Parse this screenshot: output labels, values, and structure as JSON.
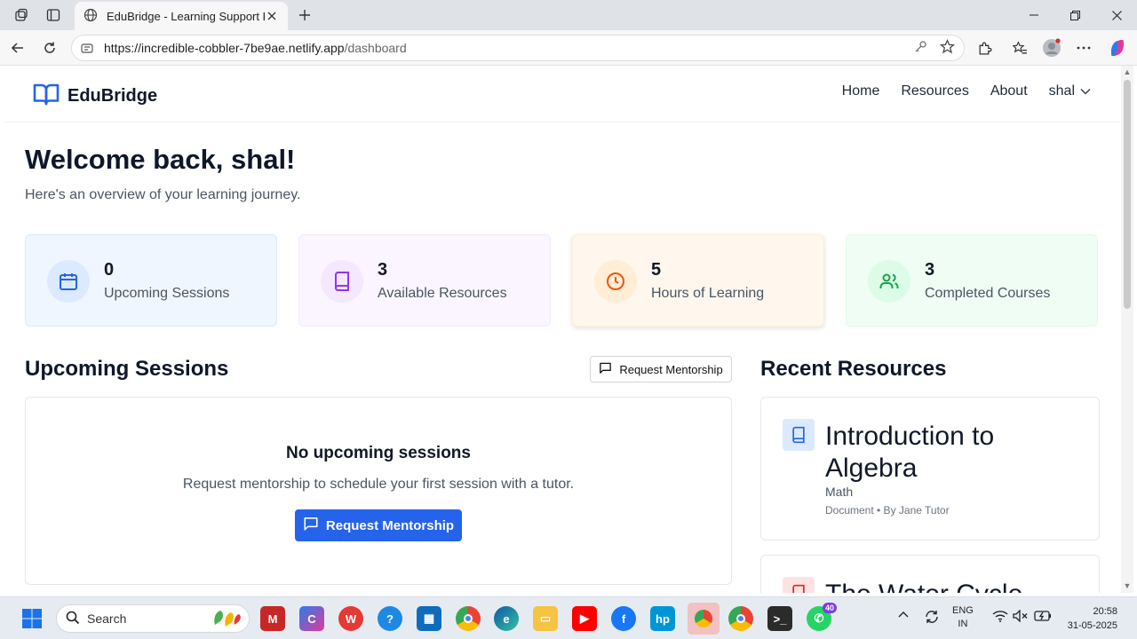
{
  "browser": {
    "tab_title": "EduBridge - Learning Support Pla",
    "url_host": "https://incredible-cobbler-7be9ae.netlify.app",
    "url_path": "/dashboard"
  },
  "app": {
    "brand": "EduBridge",
    "nav": [
      "Home",
      "Resources",
      "About"
    ],
    "user": "shal"
  },
  "welcome": {
    "title": "Welcome back, shal!",
    "subtitle": "Here's an overview of your learning journey."
  },
  "stats": [
    {
      "value": "0",
      "label": "Upcoming Sessions",
      "icon": "calendar-icon",
      "color": "#2563eb"
    },
    {
      "value": "3",
      "label": "Available Resources",
      "icon": "book-icon",
      "color": "#9333ea"
    },
    {
      "value": "5",
      "label": "Hours of Learning",
      "icon": "clock-icon",
      "color": "#ea580c"
    },
    {
      "value": "3",
      "label": "Completed Courses",
      "icon": "users-icon",
      "color": "#16a34a"
    }
  ],
  "sessions": {
    "title": "Upcoming Sessions",
    "request_button": "Request Mentorship",
    "empty_title": "No upcoming sessions",
    "empty_text": "Request mentorship to schedule your first session with a tutor.",
    "empty_button": "Request Mentorship"
  },
  "resources": {
    "title": "Recent Resources",
    "items": [
      {
        "title": "Introduction to Algebra",
        "subject": "Math",
        "meta": "Document • By Jane Tutor"
      },
      {
        "title": "The Water Cycle",
        "subject": "",
        "meta": ""
      }
    ]
  },
  "taskbar": {
    "search_placeholder": "Search",
    "lang_top": "ENG",
    "lang_bottom": "IN",
    "time": "20:58",
    "date": "31-05-2025",
    "whatsapp_badge": "40"
  }
}
